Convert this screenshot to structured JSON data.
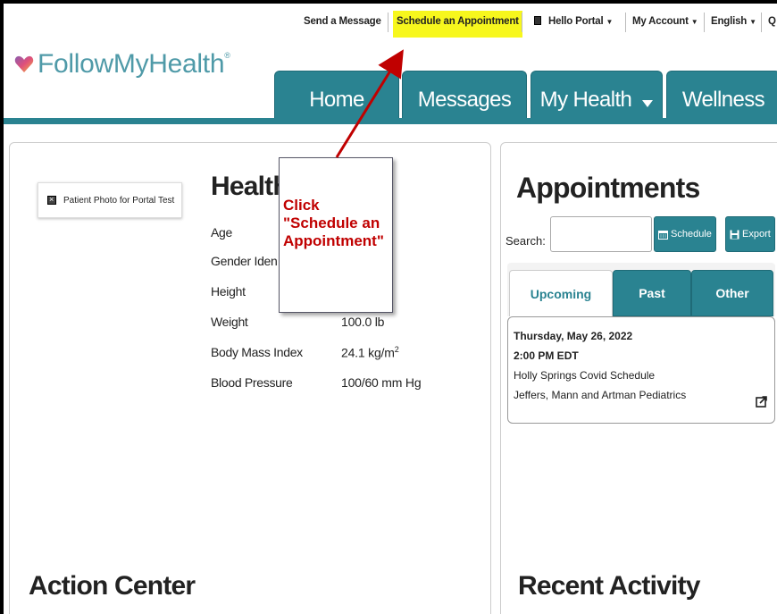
{
  "topbar": {
    "send_message": "Send a Message",
    "schedule": "Schedule an Appointment",
    "hello_portal": "Hello Portal",
    "my_account": "My Account",
    "language": "English",
    "more": "Q"
  },
  "logo": {
    "text": "FollowMyHealth",
    "mark": "®"
  },
  "nav": {
    "home": "Home",
    "messages": "Messages",
    "my_health": "My Health",
    "wellness": "Wellness"
  },
  "health": {
    "photo_alt": "Patient Photo for Portal Test",
    "title": "Health",
    "rows": [
      {
        "label": "Age",
        "value": ""
      },
      {
        "label": "Gender Iden",
        "value": ""
      },
      {
        "label": "Height",
        "value": ""
      },
      {
        "label": "Weight",
        "value": "100.0 lb"
      },
      {
        "label": "Body Mass Index",
        "value": "24.1 kg/m"
      },
      {
        "label": "Blood Pressure",
        "value": "100/60 mm Hg"
      }
    ],
    "bmi_sup": "2"
  },
  "callout": {
    "text": "Click \"Schedule an Appointment\""
  },
  "action_center": "Action Center",
  "appointments": {
    "title": "Appointments",
    "search_label": "Search:",
    "search_value": "",
    "schedule_btn": "Schedule",
    "export_btn": "Export",
    "tabs": [
      "Upcoming",
      "Past",
      "Other"
    ],
    "card": {
      "date": "Thursday, May 26, 2022",
      "time": "2:00 PM EDT",
      "location": "Holly Springs Covid Schedule",
      "provider": "Jeffers, Mann and Artman Pediatrics"
    }
  },
  "recent_activity": "Recent Activity",
  "colors": {
    "teal": "#2a8391",
    "highlight": "#f7f71d",
    "callout_text": "#c00000",
    "arrow": "#c00000"
  }
}
